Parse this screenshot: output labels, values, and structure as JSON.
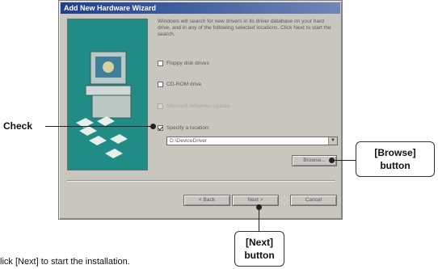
{
  "dialog": {
    "title": "Add New Hardware Wizard",
    "description": "Windows will search for new drivers in its driver database on your hard drive, and in any of the following selected locations. Click Next to start the search.",
    "options": [
      {
        "label": "Floppy disk drives",
        "checked": false,
        "enabled": true
      },
      {
        "label": "CD-ROM drive",
        "checked": false,
        "enabled": true
      },
      {
        "label": "Microsoft Windows Update",
        "checked": false,
        "enabled": false
      },
      {
        "label": "Specify a location:",
        "checked": true,
        "enabled": true
      }
    ],
    "location_value": "D:\\DeviceDriver",
    "browse_label": "Browse...",
    "back_label": "< Back",
    "next_label": "Next >",
    "cancel_label": "Cancel"
  },
  "annotations": {
    "check": "Check",
    "browse_line1": "[Browse]",
    "browse_line2": "button",
    "next_line1": "[Next]",
    "next_line2": "button"
  },
  "instruction": "lick [Next] to start the installation.",
  "colors": {
    "dialog_bg": "#c9c6c0",
    "art_bg": "#218b86",
    "titlebar": "#1e3f8c"
  }
}
